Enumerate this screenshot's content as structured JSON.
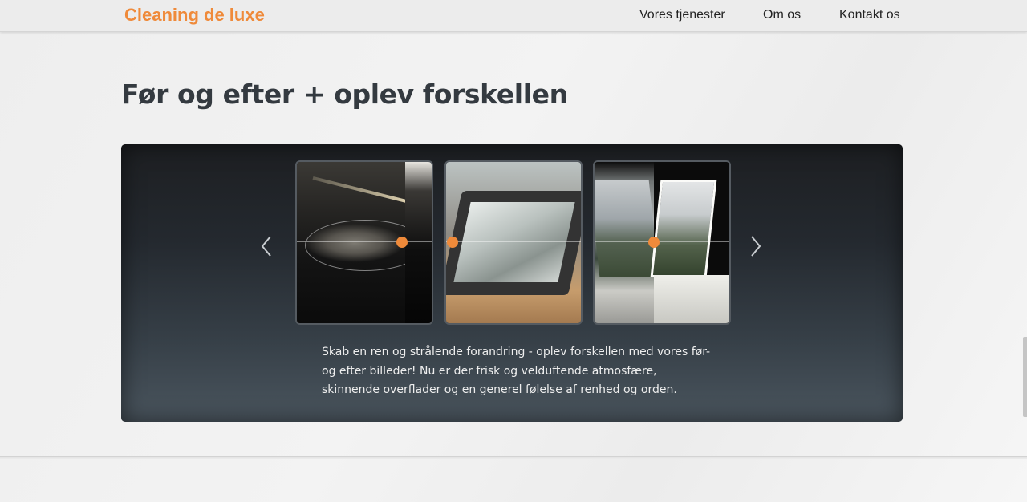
{
  "navbar": {
    "brand": "Cleaning de luxe",
    "links": [
      {
        "label": "Vores tjenester"
      },
      {
        "label": "Om os"
      },
      {
        "label": "Kontakt os"
      }
    ]
  },
  "section": {
    "title": "Før og efter + oplev forskellen",
    "caption": "Skab en ren og strålende forandring - oplev forskellen med vores før- og efter billeder! Nu er der frisk og velduftende atmosfære, skinnende overflader og en generel følelse af renhed og orden."
  },
  "carousel": {
    "prev_icon": "chevron-left-icon",
    "next_icon": "chevron-right-icon",
    "accent_color": "#ef8a3a",
    "slides": [
      {
        "subject": "stove top",
        "slider_position": 0.78
      },
      {
        "subject": "oven door",
        "slider_position": 0.05
      },
      {
        "subject": "skylight window",
        "slider_position": 0.43
      }
    ]
  },
  "colors": {
    "brand": "#ef8a3a",
    "heading": "#343a40",
    "panel_top": "#1d1f22",
    "panel_bottom": "#4a555e"
  }
}
